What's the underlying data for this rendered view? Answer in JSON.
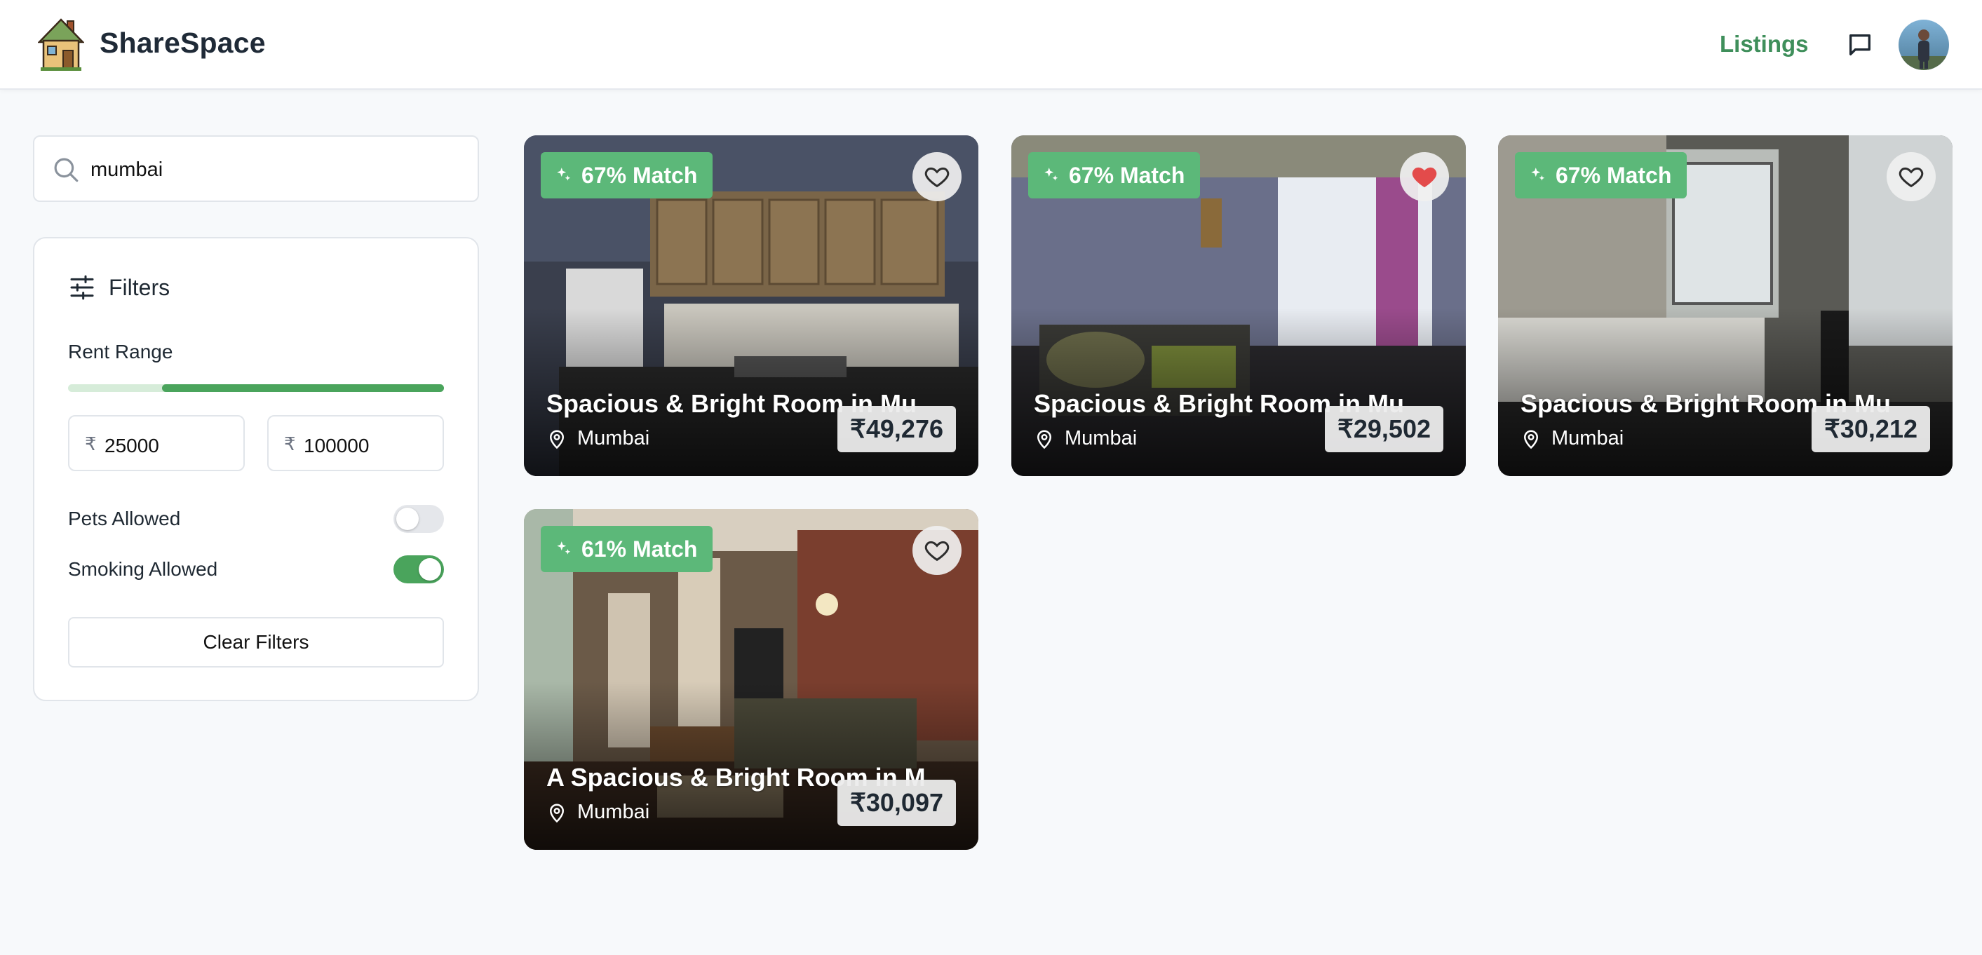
{
  "header": {
    "brand": "ShareSpace",
    "nav_listings": "Listings"
  },
  "search": {
    "value": "mumbai"
  },
  "filters": {
    "title": "Filters",
    "rent_range_label": "Rent Range",
    "range_fill_fraction": {
      "start": 0.25,
      "end": 1.0
    },
    "currency": "₹",
    "min_value": "25000",
    "max_value": "100000",
    "pets_label": "Pets Allowed",
    "pets_allowed": false,
    "smoking_label": "Smoking Allowed",
    "smoking_allowed": true,
    "clear_label": "Clear Filters"
  },
  "listings": [
    {
      "match": "67% Match",
      "title": "Spacious & Bright Room in Mu",
      "location": "Mumbai",
      "price": "₹49,276",
      "favorited": false
    },
    {
      "match": "67% Match",
      "title": "Spacious & Bright Room in Mu",
      "location": "Mumbai",
      "price": "₹29,502",
      "favorited": true
    },
    {
      "match": "67% Match",
      "title": "Spacious & Bright Room in Mu",
      "location": "Mumbai",
      "price": "₹30,212",
      "favorited": false
    },
    {
      "match": "61% Match",
      "title": "A Spacious & Bright Room in M",
      "location": "Mumbai",
      "price": "₹30,097",
      "favorited": false
    }
  ],
  "colors": {
    "brand_green": "#3f8f5b",
    "match_badge": "#5cb879",
    "toggle_on": "#4aa45c",
    "heart_active": "#e34b4b"
  }
}
